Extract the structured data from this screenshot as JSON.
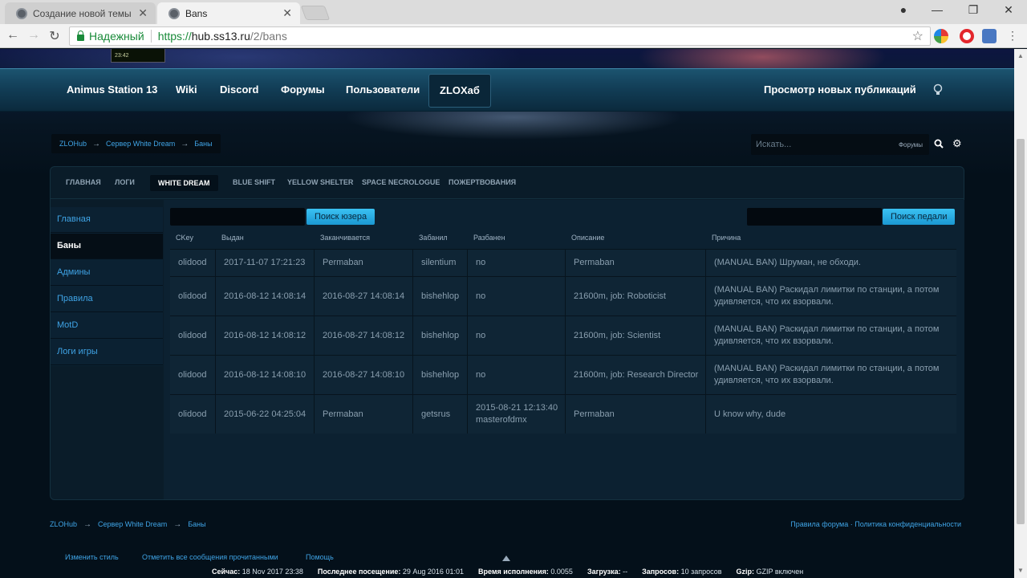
{
  "browser": {
    "tabs": [
      {
        "title": "Создание новой темы - "
      },
      {
        "title": "Bans"
      }
    ],
    "address": {
      "secure_label": "Надежный",
      "protocol": "https://",
      "host": "hub.ss13.ru",
      "path": "/2/bans"
    }
  },
  "clock": "23:42",
  "nav": {
    "items": [
      "Animus Station 13",
      "Wiki",
      "Discord",
      "Форумы",
      "Пользователи",
      "ZLOXаб"
    ],
    "active": "ZLOXаб",
    "right": "Просмотр новых публикаций"
  },
  "breadcrumb": [
    "ZLOHub",
    "Сервер White Dream",
    "Баны"
  ],
  "search": {
    "placeholder": "Искать...",
    "scope": "Форумы"
  },
  "subtabs": [
    "Главная",
    "Логи",
    "White Dream",
    "Blue Shift",
    "Yellow Shelter",
    "Space Necrologue",
    "Пожертвования"
  ],
  "active_subtab": "White Dream",
  "sidebar": [
    "Главная",
    "Баны",
    "Админы",
    "Правила",
    "MotD",
    "Логи игры"
  ],
  "active_sidebar": "Баны",
  "buttons": {
    "search_user": "Поиск юзера",
    "search_admin": "Поиск педали"
  },
  "table": {
    "headers": [
      "CKey",
      "Выдан",
      "Заканчивается",
      "Забанил",
      "Разбанен",
      "Описание",
      "Причина"
    ],
    "rows": [
      {
        "ckey": "olidood",
        "issued": "2017-11-07 17:21:23",
        "expires": "Permaban",
        "by": "silentium",
        "unbanned": "no",
        "desc": "Permaban",
        "reason": "(MANUAL BAN) Шруман, не обходи."
      },
      {
        "ckey": "olidood",
        "issued": "2016-08-12 14:08:14",
        "expires": "2016-08-27 14:08:14",
        "by": "bishehlop",
        "unbanned": "no",
        "desc": "21600m, job: Roboticist",
        "reason": "(MANUAL BAN) Раскидал лимитки по станции, а потом удивляется, что их взорвали."
      },
      {
        "ckey": "olidood",
        "issued": "2016-08-12 14:08:12",
        "expires": "2016-08-27 14:08:12",
        "by": "bishehlop",
        "unbanned": "no",
        "desc": "21600m, job: Scientist",
        "reason": "(MANUAL BAN) Раскидал лимитки по станции, а потом удивляется, что их взорвали."
      },
      {
        "ckey": "olidood",
        "issued": "2016-08-12 14:08:10",
        "expires": "2016-08-27 14:08:10",
        "by": "bishehlop",
        "unbanned": "no",
        "desc": "21600m, job: Research Director",
        "reason": "(MANUAL BAN) Раскидал лимитки по станции, а потом удивляется, что их взорвали."
      },
      {
        "ckey": "olidood",
        "issued": "2015-06-22 04:25:04",
        "expires": "Permaban",
        "by": "getsrus",
        "unbanned": "2015-08-21 12:13:40 masterofdmx",
        "desc": "Permaban",
        "reason": "U know why, dude"
      }
    ]
  },
  "footer": {
    "breadcrumb": [
      "ZLOHub",
      "Сервер White Dream",
      "Баны"
    ],
    "right_links": [
      "Правила форума",
      "Политика конфиденциальности"
    ],
    "links": [
      "Изменить стиль",
      "Отметить все сообщения прочитанными",
      "Помощь"
    ],
    "stats": [
      {
        "label": "Сейчас:",
        "value": "18 Nov 2017 23:38"
      },
      {
        "label": "Последнее посещение:",
        "value": "29 Aug 2016 01:01"
      },
      {
        "label": "Время исполнения:",
        "value": "0.0055"
      },
      {
        "label": "Загрузка:",
        "value": "--"
      },
      {
        "label": "Запросов:",
        "value": "10 запросов"
      },
      {
        "label": "Gzip:",
        "value": "GZIP включен"
      }
    ]
  }
}
